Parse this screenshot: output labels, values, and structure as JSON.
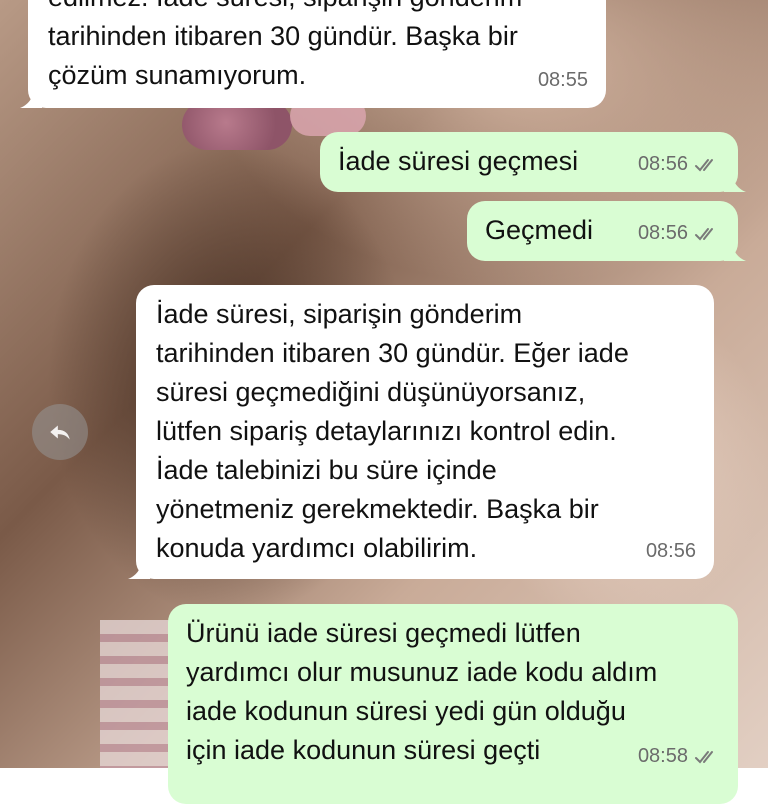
{
  "messages": [
    {
      "direction": "incoming",
      "lines": [
        "edilmez. İade süresi, siparişin gönderim",
        "tarihinden itibaren 30 gündür. Başka bir",
        "çözüm sunamıyorum."
      ],
      "time": "08:55"
    },
    {
      "direction": "outgoing",
      "lines": [
        "İade süresi geçmesi"
      ],
      "time": "08:56",
      "status_icon": "double-check-icon"
    },
    {
      "direction": "outgoing",
      "lines": [
        "Geçmedi"
      ],
      "time": "08:56",
      "status_icon": "double-check-icon"
    },
    {
      "direction": "incoming",
      "lines": [
        "İade süresi, siparişin gönderim",
        "tarihinden itibaren 30 gündür. Eğer iade",
        "süresi geçmediğini düşünüyorsanız,",
        "lütfen sipariş detaylarınızı kontrol edin.",
        "İade talebinizi bu süre içinde",
        "yönetmeniz gerekmektedir. Başka bir",
        "konuda yardımcı olabilirim."
      ],
      "time": "08:56"
    },
    {
      "direction": "outgoing",
      "lines": [
        "Ürünü iade süresi geçmedi lütfen",
        "yardımcı olur musunuz iade kodu aldım",
        "iade kodunun süresi yedi gün olduğu",
        "için iade kodunun süresi geçti"
      ],
      "time": "08:58",
      "status_icon": "double-check-icon"
    }
  ],
  "reply_icon": "reply-arrow-icon",
  "colors": {
    "incoming_bubble": "#ffffff",
    "outgoing_bubble": "#d9fdd3",
    "meta_text": "#6b6b6b"
  }
}
